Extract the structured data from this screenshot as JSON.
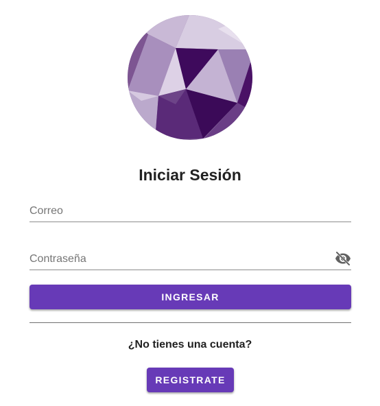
{
  "login": {
    "title": "Iniciar Sesión",
    "email_placeholder": "Correo",
    "email_value": "",
    "password_placeholder": "Contraseña",
    "password_value": "",
    "password_visibility_icon": "eye-off-icon",
    "submit_label": "INGRESAR",
    "signup_prompt": "¿No tienes una cuenta?",
    "register_label": "REGISTRATE"
  },
  "theme": {
    "primary": "#673ab7",
    "divider": "#6f6f6f",
    "text": "#212121"
  }
}
